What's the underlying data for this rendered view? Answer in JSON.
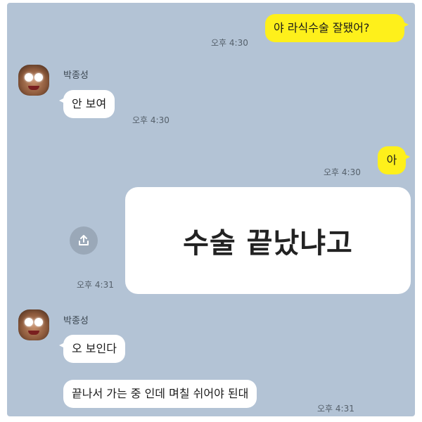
{
  "messages": [
    {
      "sender": "me",
      "text": "야 라식수술 잘됐어?",
      "time": "오후 4:30"
    },
    {
      "sender": "박종성",
      "name": "박종성",
      "text": "안 보여",
      "time": "오후 4:30"
    },
    {
      "sender": "me",
      "text": "아",
      "time": "오후 4:30"
    },
    {
      "sender": "me",
      "text": "수술 끝났냐고",
      "time": "오후 4:31",
      "style": "large-card"
    },
    {
      "sender": "박종성",
      "name": "박종성",
      "text": "오 보인다"
    },
    {
      "sender": "박종성",
      "text": "끝나서 가는 중 인데 며칠 쉬어야 된대",
      "time": "오후 4:31"
    }
  ],
  "icons": {
    "share": "share-upload-icon",
    "avatar": "profile-avatar"
  },
  "colors": {
    "background": "#b3c3d5",
    "outgoing": "#fef01b",
    "incoming": "#ffffff"
  }
}
